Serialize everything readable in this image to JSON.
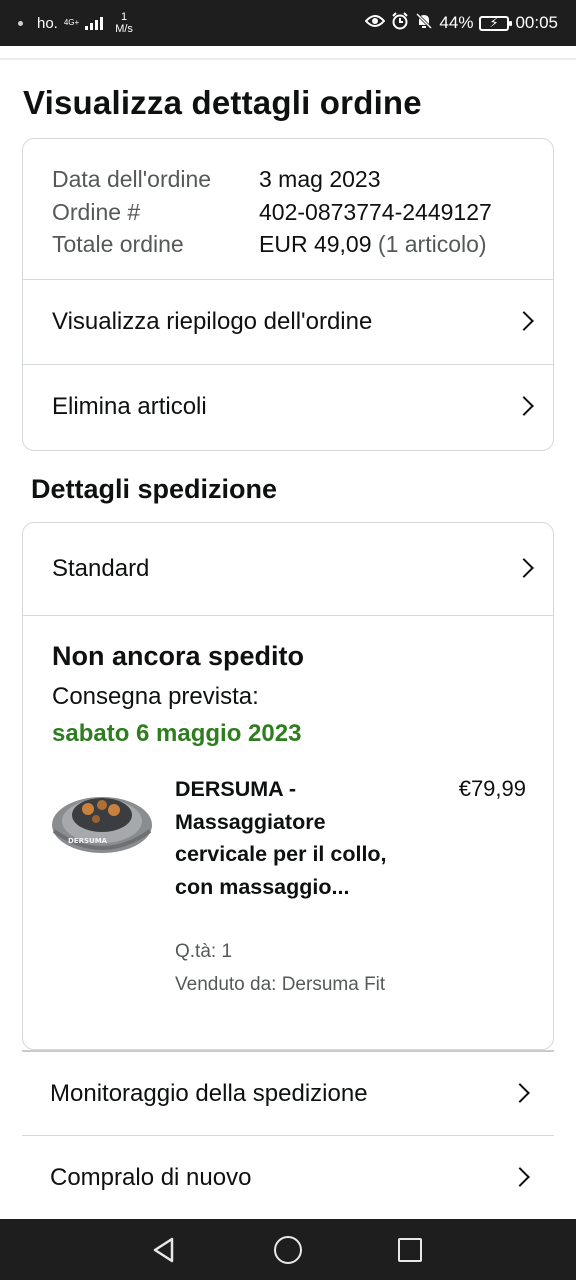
{
  "status_bar": {
    "carrier": "ho.",
    "network": "4G+",
    "speed_value": "1",
    "speed_unit": "M/s",
    "battery_percent": "44%",
    "time": "00:05",
    "icons": [
      "eye-icon",
      "alarm-icon",
      "bell-muted-icon",
      "battery-charging-icon"
    ]
  },
  "page": {
    "title": "Visualizza dettagli ordine"
  },
  "order": {
    "date_label": "Data dell'ordine",
    "date_value": "3 mag 2023",
    "number_label": "Ordine #",
    "number_value": "402-0873774-2449127",
    "total_label": "Totale ordine",
    "total_value": "EUR 49,09",
    "total_items": "(1 articolo)",
    "summary_link": "Visualizza riepilogo dell'ordine",
    "delete_link": "Elimina articoli"
  },
  "shipping": {
    "section_title": "Dettagli spedizione",
    "method": "Standard",
    "status": "Non ancora spedito",
    "expected_label": "Consegna prevista:",
    "expected_date": "sabato 6 maggio 2023",
    "date_color": "#2e7d1e"
  },
  "product": {
    "name": "DERSUMA - Massaggiatore cervicale per il collo, con massaggio...",
    "price": "€79,99",
    "quantity": "Q.tà: 1",
    "seller": "Venduto da: Dersuma Fit",
    "image_label": "DERSUMA"
  },
  "actions": {
    "track": "Monitoraggio della spedizione",
    "buy_again": "Compralo di nuovo"
  },
  "colors": {
    "border": "#d5d9d9",
    "text": "#0f1111",
    "muted": "#565959",
    "bars": "#1e1e1e"
  }
}
